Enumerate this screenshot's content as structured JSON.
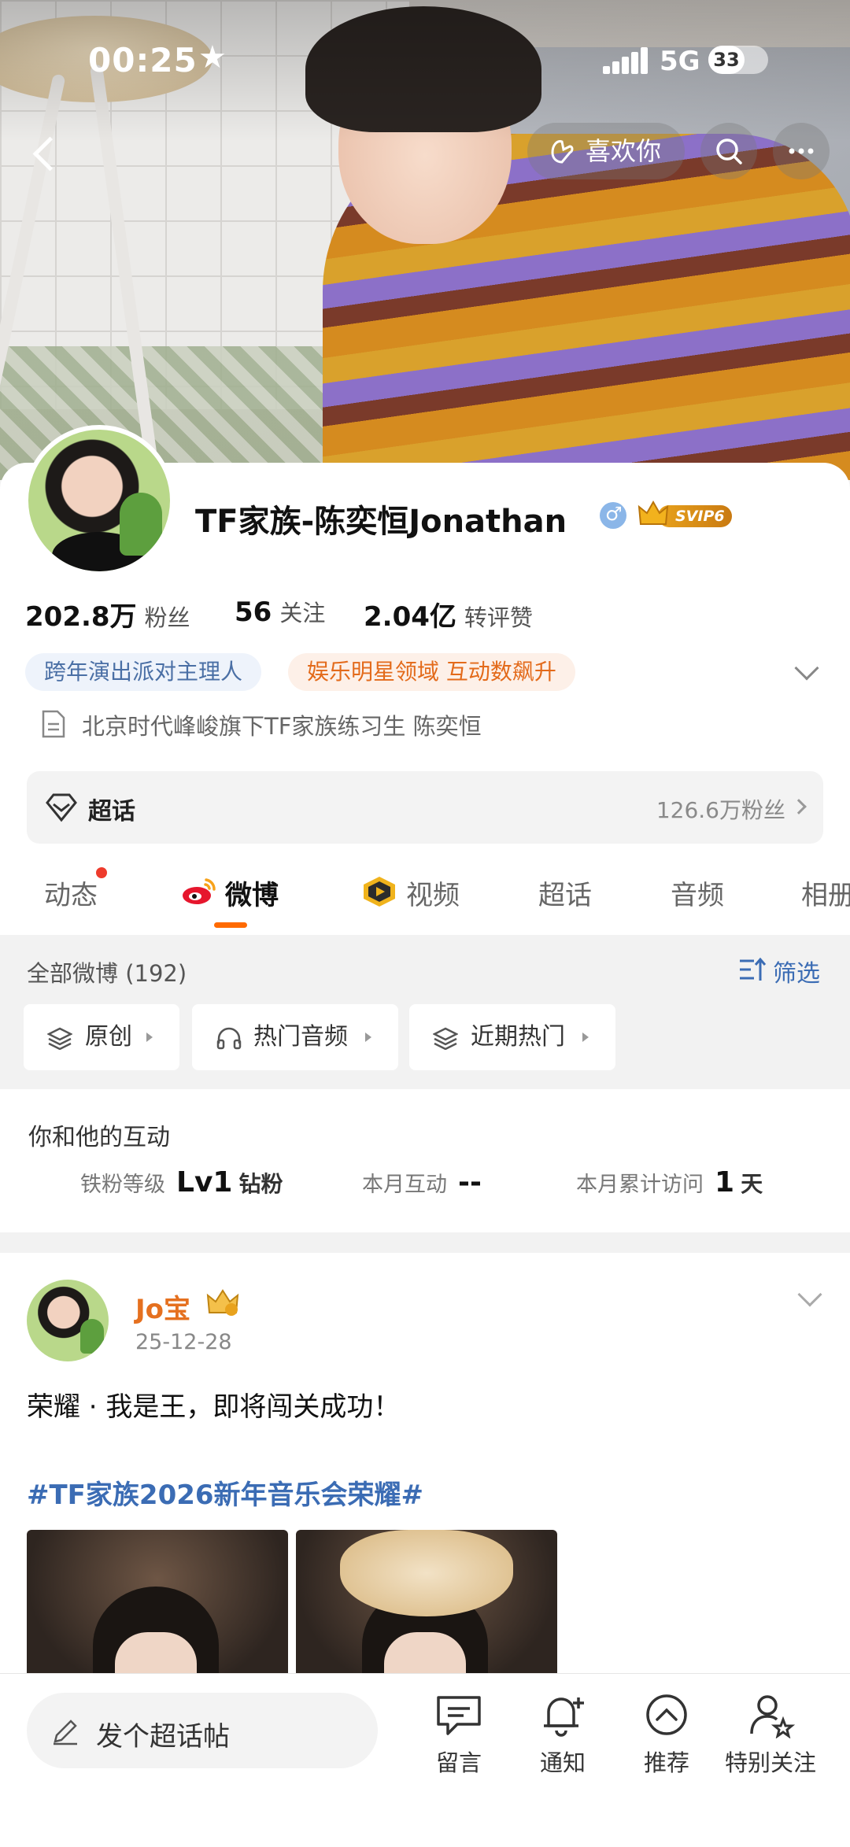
{
  "status_bar": {
    "time": "00:25",
    "network": "5G",
    "battery": "33"
  },
  "header": {
    "like_label": "喜欢你"
  },
  "profile": {
    "name": "TF家族-陈奕恒Jonathan",
    "vip_badge": "SVIP6",
    "stats": [
      {
        "value": "202.8万",
        "label": "粉丝"
      },
      {
        "value": "56",
        "label": "关注"
      },
      {
        "value": "2.04亿",
        "label": "转评赞"
      }
    ],
    "tags": [
      "跨年演出派对主理人",
      "娱乐明星领域 互动数飙升"
    ],
    "bio": "北京时代峰峻旗下TF家族练习生 陈奕恒",
    "super_topic": {
      "label": "超话",
      "fans": "126.6万粉丝"
    }
  },
  "tabs": [
    {
      "label": "动态"
    },
    {
      "label": "微博"
    },
    {
      "label": "视频"
    },
    {
      "label": "超话"
    },
    {
      "label": "音频"
    },
    {
      "label": "相册"
    }
  ],
  "filter": {
    "all_posts": "全部微博 (192)",
    "filter_label": "筛选",
    "chips": [
      "原创",
      "热门音频",
      "近期热门"
    ]
  },
  "interaction": {
    "title": "你和他的互动",
    "metrics": [
      {
        "key": "铁粉等级",
        "value": "Lv1",
        "unit": "钻粉"
      },
      {
        "key": "本月互动",
        "value": "--",
        "unit": ""
      },
      {
        "key": "本月累计访问",
        "value": "1",
        "unit": "天"
      }
    ]
  },
  "post": {
    "author": "Jo宝",
    "date": "25-12-28",
    "text": "荣耀 · 我是王，即将闯关成功！",
    "hashtag": "#TF家族2026新年音乐会荣耀#"
  },
  "bottom_bar": {
    "compose_label": "发个超话帖",
    "items": [
      {
        "label": "留言",
        "icon": "message-icon"
      },
      {
        "label": "通知",
        "icon": "bell-plus-icon"
      },
      {
        "label": "推荐",
        "icon": "chevron-up-circle-icon"
      },
      {
        "label": "特别关注",
        "icon": "user-star-icon"
      }
    ]
  },
  "colors": {
    "accent": "#ff6a00",
    "link": "#3b6cb4",
    "name_orange": "#e5701f",
    "notification_dot": "#ee3b2c"
  }
}
